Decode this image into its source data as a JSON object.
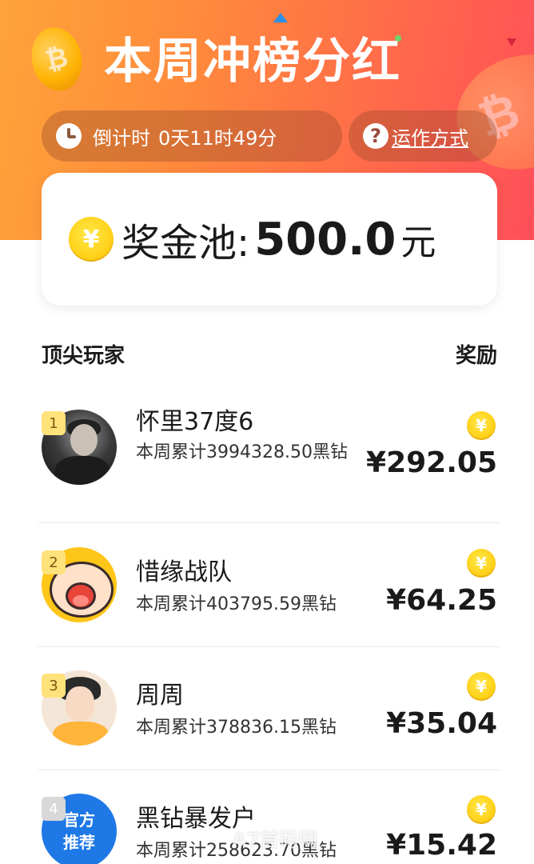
{
  "header": {
    "title": "本周冲榜分红",
    "countdown_label": "倒计时",
    "countdown_value": "0天11时49分",
    "howto_label": "运作方式"
  },
  "prize_pool": {
    "coin_symbol": "¥",
    "label": "奖金池:",
    "amount": "500.0",
    "unit": "元"
  },
  "leaderboard": {
    "header_left": "顶尖玩家",
    "header_right": "奖励",
    "coin_symbol": "¥",
    "players": [
      {
        "rank": "1",
        "name": "怀里37度6",
        "weekly": "本周累计3994328.50黑钻",
        "reward": "¥292.05"
      },
      {
        "rank": "2",
        "name": "惜缘战队",
        "weekly": "本周累计403795.59黑钻",
        "reward": "¥64.25"
      },
      {
        "rank": "3",
        "name": "周周",
        "weekly": "本周累计378836.15黑钻",
        "reward": "¥35.04"
      },
      {
        "rank": "4",
        "name": "黑钻暴发户",
        "weekly": "本周累计258623.70黑钻",
        "reward": "¥15.42",
        "avatar_text": [
          "官方",
          "推荐"
        ]
      }
    ]
  },
  "watermark": "A7首码网",
  "colors": {
    "hero_start": "#ffa33a",
    "hero_end": "#ff4f5a",
    "coin": "#ffd21a",
    "rank_badge": "#ffe27a",
    "official_avatar": "#1e78e6"
  }
}
